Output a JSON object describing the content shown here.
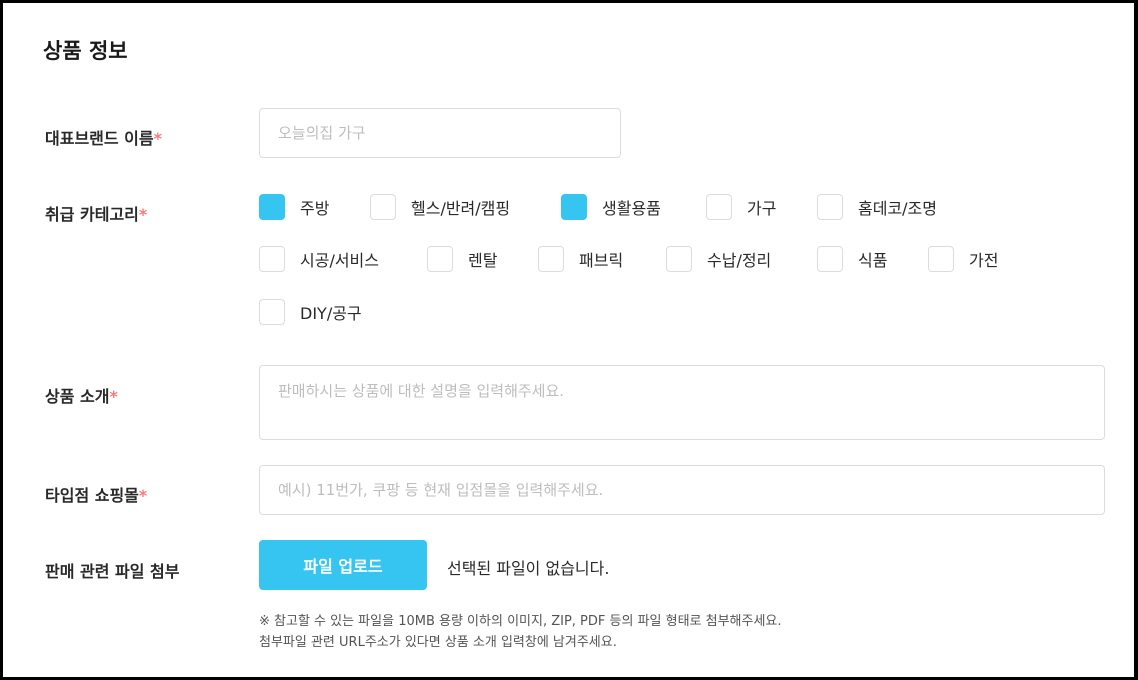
{
  "section": {
    "title": "상품 정보"
  },
  "required_mark": "*",
  "brand": {
    "label": "대표브랜드 이름",
    "placeholder": "오늘의집 가구",
    "value": ""
  },
  "category": {
    "label": "취급 카테고리",
    "options": [
      {
        "label": "주방",
        "checked": true
      },
      {
        "label": "헬스/반려/캠핑",
        "checked": false
      },
      {
        "label": "생활용품",
        "checked": true
      },
      {
        "label": "가구",
        "checked": false
      },
      {
        "label": "홈데코/조명",
        "checked": false
      },
      {
        "label": "시공/서비스",
        "checked": false
      },
      {
        "label": "렌탈",
        "checked": false
      },
      {
        "label": "패브릭",
        "checked": false
      },
      {
        "label": "수납/정리",
        "checked": false
      },
      {
        "label": "식품",
        "checked": false
      },
      {
        "label": "가전",
        "checked": false
      },
      {
        "label": "DIY/공구",
        "checked": false
      }
    ]
  },
  "intro": {
    "label": "상품 소개",
    "placeholder": "판매하시는 상품에 대한 설명을 입력해주세요.",
    "value": ""
  },
  "other_mall": {
    "label": "타입점 쇼핑몰",
    "placeholder": "예시) 11번가, 쿠팡 등 현재 입점몰을 입력해주세요.",
    "value": ""
  },
  "attachment": {
    "label": "판매 관련 파일 첨부",
    "button_label": "파일 업로드",
    "status": "선택된 파일이 없습니다.",
    "notice_line1": "※ 참고할 수 있는 파일을 10MB 용량 이하의 이미지, ZIP, PDF 등의 파일 형태로 첨부해주세요.",
    "notice_line2": "첨부파일 관련 URL주소가 있다면 상품 소개 입력창에 남겨주세요."
  },
  "colors": {
    "accent": "#35c5f0",
    "required": "#f77b7b",
    "border": "#dcdcdc",
    "placeholder": "#bdbdbd"
  }
}
